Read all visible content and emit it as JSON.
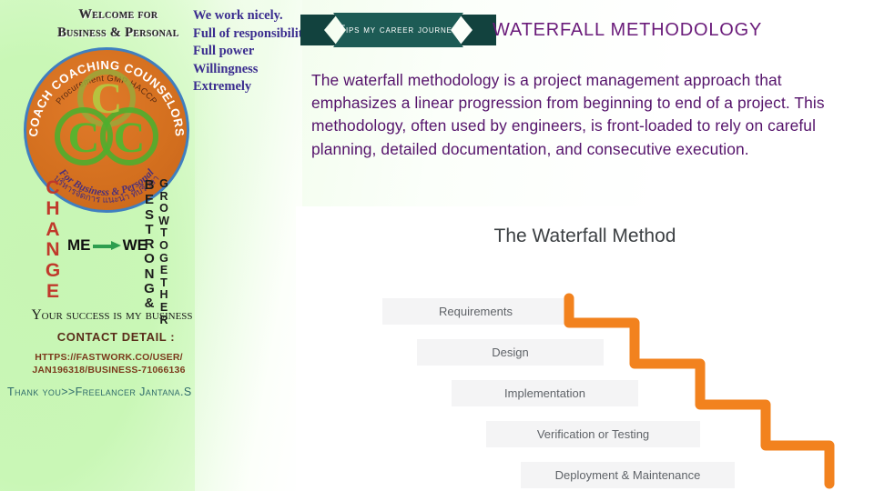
{
  "left_panel": {
    "welcome_line1": "Welcome for",
    "welcome_line2": "Business & Personal",
    "logo": {
      "arc_top": "COACH COACHING COUNSELORS",
      "arc_top_inner": "Procurement   GMP HACCP",
      "arc_bottom_inner": "For Business & Personal",
      "arc_bottom_thai": "บริหารจัดการ  แนะนำ ที่ปรึกษา",
      "letters": "CCC",
      "disc_color": "#d4701f",
      "ring_color": "#3f7fc0",
      "letter_color": "#6ab023"
    },
    "acrostic_change": "CHANGE",
    "acrostic_bestrong": "BESTRONG&",
    "acrostic_grow": "GROWTOGETHER",
    "me_label": "ME",
    "we_label": "WE",
    "change_color": "#c0392b",
    "arrow_color": "#2e9e4f",
    "success_line": "Your success is my business",
    "contact_title": "CONTACT DETAIL :",
    "contact_url_line1": "HTTPS://FASTWORK.CO/USER/",
    "contact_url_line2": "JAN196318/BUSINESS-71066136",
    "thanks_line": "Thank you>>Freelancer Jantana.S"
  },
  "bullets": {
    "color": "#3b2d8f",
    "items": [
      "We work nicely.",
      "Full of responsibility",
      "Full power",
      "Willingness",
      "Extremely"
    ]
  },
  "ribbon": {
    "label": "Tips my career journey",
    "fill": "#1d5b55",
    "shadow": "#12423e",
    "text_color": "#ffffff"
  },
  "header": {
    "title": "WATERFALL METHODOLOGY",
    "title_color": "#6a1b7a"
  },
  "body": {
    "paragraph": "The waterfall methodology is a project management approach that emphasizes a linear progression from beginning to end of a project. This methodology, often used by engineers, is front-loaded to rely on careful planning, detailed documentation, and consecutive execution.",
    "text_color": "#55136b"
  },
  "chart_data": {
    "type": "bar",
    "title": "The Waterfall Method",
    "subtitle": "",
    "xlabel": "",
    "ylabel": "",
    "categories": [
      "Requirements",
      "Design",
      "Implementation",
      "Verification or Testing",
      "Deployment & Maintenance"
    ],
    "values": [
      1,
      2,
      3,
      4,
      5
    ],
    "annotations": [
      "Cascading stair-step flow from Requirements down to Deployment & Maintenance"
    ],
    "legend": [],
    "grid": false,
    "bar_fill": "#f4f4f5",
    "bar_text_color": "#5f6368",
    "step_line_color": "#f2821e",
    "title_color": "#3c4043"
  }
}
